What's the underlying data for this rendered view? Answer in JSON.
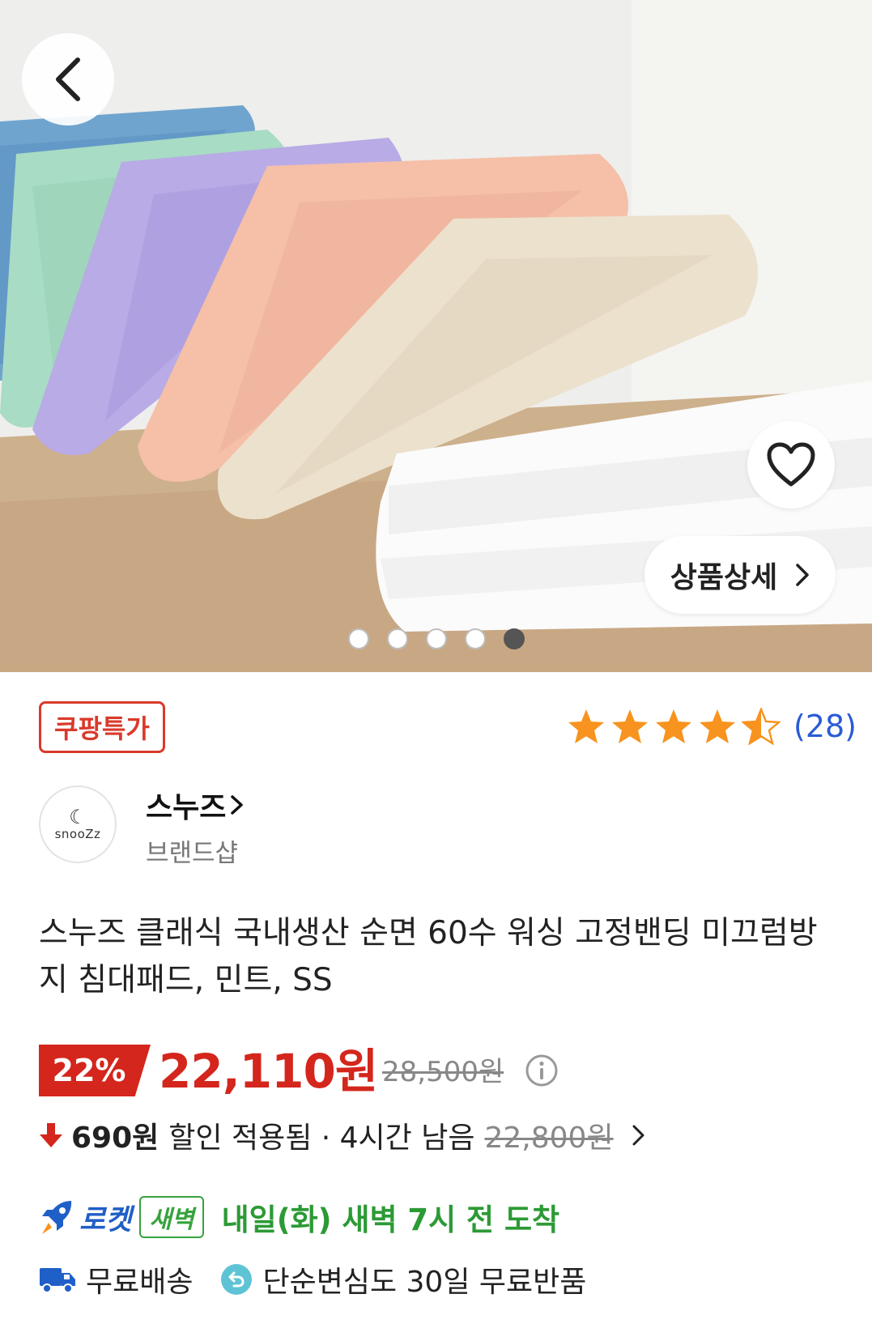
{
  "hero": {
    "detail_button_label": "상품상세",
    "image_count": 5,
    "active_image": 5
  },
  "badge": {
    "label": "쿠팡특가"
  },
  "rating": {
    "stars": 4.5,
    "review_count_text": "(28)"
  },
  "brand": {
    "logo_text": "snooZz",
    "name": "스누즈",
    "sub": "브랜드샵"
  },
  "product": {
    "title": "스누즈 클래식 국내생산 순면 60수 워싱 고정밴딩 미끄럼방지 침대패드, 민트, SS"
  },
  "price": {
    "discount_rate": "22%",
    "sale_price": "22,110원",
    "original_price": "28,500원"
  },
  "extra_discount": {
    "amount": "690원",
    "text": "할인 적용됨 · 4시간 남음",
    "previous_price": "22,800원"
  },
  "delivery": {
    "rocket_label": "로켓",
    "dawn_label": "새벽",
    "arrival_text": "내일(화) 새벽 7시 전 도착",
    "free_shipping": "무료배송",
    "return_policy": "단순변심도 30일 무료반품"
  },
  "colors": {
    "accent_red": "#d4261c",
    "rocket_blue": "#1f5fc8",
    "dawn_green": "#2c9a35",
    "star_orange": "#f7931e",
    "review_blue": "#2a5bd7"
  }
}
